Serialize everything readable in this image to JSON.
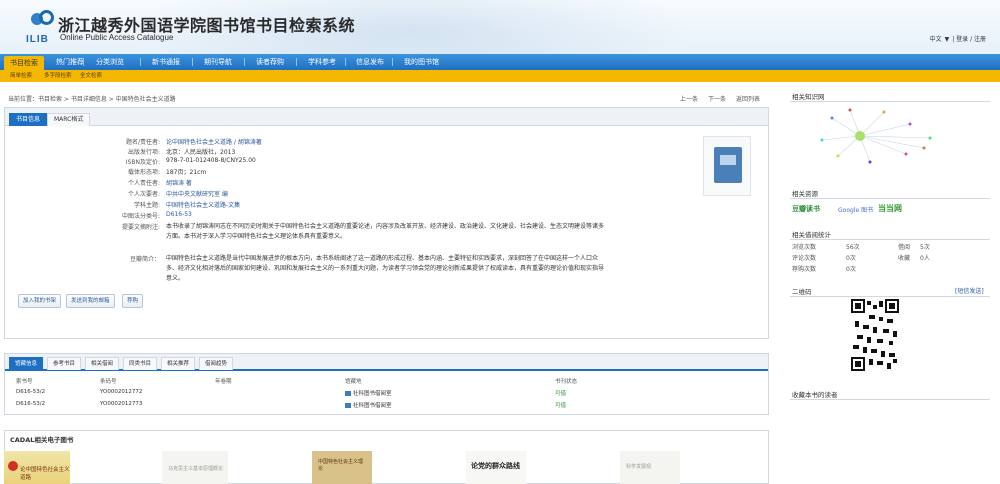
{
  "header": {
    "logo_text": "ILIB",
    "title": "浙江越秀外国语学院图书馆书目检索系统",
    "subtitle": "Online Public Access Catalogue",
    "lang": "中文",
    "lang_arrow": "▼",
    "login": "| 登录 / 注册"
  },
  "nav": {
    "items": [
      "书目检索",
      "热门推荐",
      "分类浏览",
      "新书通报",
      "期刊导航",
      "读者荐购",
      "学科参考",
      "信息发布",
      "我的图书馆"
    ],
    "active_index": 0
  },
  "subnav": {
    "items": [
      "简单检索",
      "多字段检索",
      "全文检索"
    ]
  },
  "breadcrumb": {
    "text": "当前位置：书目检索 > 书目详细信息 > 中国特色社会主义道路",
    "links": [
      "上一条",
      "下一条",
      "返回列表"
    ]
  },
  "detail": {
    "tabs": [
      "书目信息",
      "MARC格式"
    ],
    "fields": [
      {
        "label": "题名/责任者:",
        "value": "论中国特色社会主义道路 / 胡锦涛著",
        "link": true
      },
      {
        "label": "出版发行项:",
        "value": "北京：人民出版社，2013",
        "link": false
      },
      {
        "label": "ISBN及定价:",
        "value": "978-7-01-012408-8/CNY25.00",
        "link": false
      },
      {
        "label": "载体形态项:",
        "value": "187页；21cm",
        "link": false
      },
      {
        "label": "个人责任者:",
        "value": "胡锦涛 著",
        "link": true
      },
      {
        "label": "个人次要者:",
        "value": "中共中央文献研究室 编",
        "link": true
      },
      {
        "label": "学科主题:",
        "value": "中国特色社会主义道路-文集",
        "link": true
      },
      {
        "label": "中图法分类号:",
        "value": "D616-53",
        "link": true
      }
    ],
    "summary_label": "提要文摘附注:",
    "summary": "本书收录了胡锦涛同志在不同历史时期关于中国特色社会主义道路的重要论述，内容涉及改革开放、经济建设、政治建设、文化建设、社会建设、生态文明建设等诸多方面。本书对于深入学习中国特色社会主义理论体系具有重要意义。",
    "review_label": "豆瓣简介：",
    "review": "中国特色社会主义道路是当代中国发展进步的根本方向，本书系统阐述了这一道路的形成过程、基本内涵、主要特征和实践要求，深刻回答了在中国这样一个人口众多、经济文化相对落后的国家如何建设、巩固和发展社会主义的一系列重大问题，为读者学习领会党的理论创新成果提供了权威读本，具有重要的理论价值和现实指导意义。",
    "buttons": [
      "加入我的书架",
      "发送到我的邮箱",
      "荐购"
    ]
  },
  "holdings": {
    "tabs": [
      "馆藏信息",
      "参考书目",
      "相关借阅",
      "同类书目",
      "相关推荐",
      "借阅趋势"
    ],
    "columns": [
      "索书号",
      "条码号",
      "年卷期",
      "馆藏地",
      "书刊状态"
    ],
    "rows": [
      {
        "call": "D616-53/2",
        "barcode": "YO0002012772",
        "volume": "",
        "location": "社科图书借阅室",
        "status": "可借"
      },
      {
        "call": "D616-53/2",
        "barcode": "YO0002012773",
        "volume": "",
        "location": "社科图书借阅室",
        "status": "可借"
      }
    ]
  },
  "cadal": {
    "title": "CADAL相关电子图书",
    "covers": [
      "论中国特色社会主义道路",
      "马克思主义基本原理概论",
      "中国特色社会主义理论",
      "论党的群众路线",
      "科学发展观"
    ]
  },
  "sidebar": {
    "relation_title": "相关知识网",
    "related_title": "相关资源",
    "douban": "豆瓣读书",
    "google": "Google 图书",
    "dangdang": "当当网",
    "stats_title": "相关借阅统计",
    "stats": [
      {
        "k": "浏览次数",
        "v": "56次",
        "k2": "借阅",
        "v2": "5次"
      },
      {
        "k": "评论次数",
        "v": "0次",
        "k2": "收藏",
        "v2": "0人"
      },
      {
        "k": "荐购次数",
        "v": "0次",
        "k2": "",
        "v2": ""
      }
    ],
    "qr_title": "二维码",
    "qr_link": "[短信发送]",
    "more_title": "收藏本书的读者"
  },
  "colors": {
    "nav_blue": "#1f6fc2",
    "accent_yellow": "#f5b800",
    "link_blue": "#2c5aa0",
    "status_green": "#2f9a2f"
  }
}
